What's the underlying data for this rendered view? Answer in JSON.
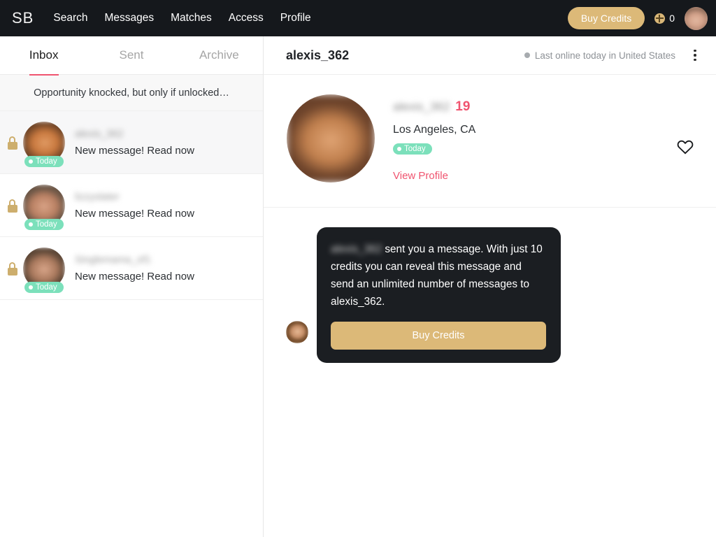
{
  "nav": {
    "brand": "SB",
    "links": [
      {
        "label": "Search"
      },
      {
        "label": "Messages"
      },
      {
        "label": "Matches"
      },
      {
        "label": "Access"
      },
      {
        "label": "Profile"
      }
    ],
    "buy_credits_label": "Buy Credits",
    "credits_count": "0",
    "coin_icon": "coin-icon",
    "avatar_icon": "user-avatar"
  },
  "inbox": {
    "tabs": [
      {
        "label": "Inbox",
        "active": true
      },
      {
        "label": "Sent",
        "active": false
      },
      {
        "label": "Archive",
        "active": false
      }
    ],
    "promo_banner": "Opportunity knocked, but only if unlocked…",
    "conversations": [
      {
        "name": "alexis_362",
        "preview": "New message! Read now",
        "badge": "Today",
        "locked": true,
        "selected": true
      },
      {
        "name": "lizzyslater",
        "preview": "New message! Read now",
        "badge": "Today",
        "locked": true,
        "selected": false
      },
      {
        "name": "Singlemama_of1",
        "preview": "New message! Read now",
        "badge": "Today",
        "locked": true,
        "selected": false
      }
    ]
  },
  "chat": {
    "title": "alexis_362",
    "status": "Last online today in United States",
    "menu_icon": "kebab-menu-icon",
    "profile": {
      "name": "alexis_362",
      "age": "19",
      "city": "Los Angeles, CA",
      "badge": "Today",
      "view_profile_label": "View Profile",
      "favorite_icon": "heart-icon"
    },
    "message": {
      "sender_blurred": "alexis_362",
      "body": " sent you a message. With just 10 credits you can reveal this message and send an unlimited number of messages to alexis_362.",
      "cta_label": "Buy Credits"
    }
  },
  "colors": {
    "nav_bg": "#15181c",
    "gold": "#dcb978",
    "pink": "#f0546f",
    "mint": "#7ce0bb",
    "bubble_bg": "#1b1e22",
    "lock": "#cdae6d"
  }
}
